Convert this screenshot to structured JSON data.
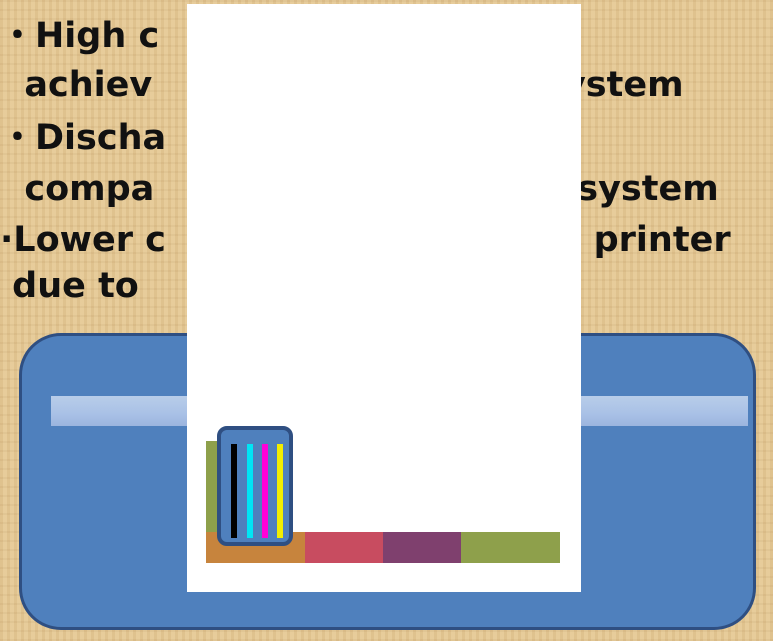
{
  "text_lines": [
    "・High c",
    "  achiev                                system",
    "・Discha",
    "  compa                                s system",
    "·Lower c                              nd printer",
    " due to"
  ],
  "ink_cartridges": [
    {
      "name": "black",
      "color": "#000000"
    },
    {
      "name": "cyan",
      "color": "#00e5f5"
    },
    {
      "name": "magenta",
      "color": "#ff00d8"
    },
    {
      "name": "yellow",
      "color": "#f2ee00"
    }
  ],
  "printed_colors": [
    "#c7843d",
    "#c84c60",
    "#7f406e",
    "#8ea04b"
  ],
  "colors": {
    "printer_body": "#4f80bd",
    "printer_border": "#2f4f82",
    "rail": "#a9c1e6",
    "paper": "#ffffff",
    "background": "#e2c592"
  }
}
